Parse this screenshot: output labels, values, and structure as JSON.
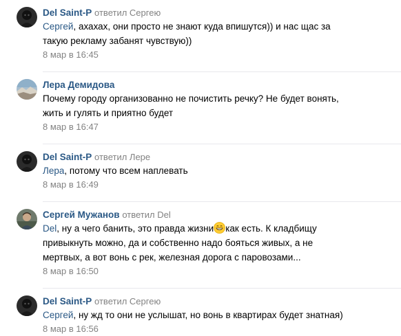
{
  "comments": [
    {
      "author": "Del Saint-P",
      "reply_word": "ответил",
      "reply_target": "Сергею",
      "avatar": "avatar-dark",
      "mention": "Сергей",
      "lines": [
        ", ахахах, они просто не знают куда впишутся)) и нас щас за",
        "такую рекламу забанят чувствую))"
      ],
      "date": "8 мар в 16:45"
    },
    {
      "author": "Лера Демидова",
      "reply_word": "",
      "reply_target": "",
      "avatar": "avatar-landscape",
      "mention": "",
      "lines": [
        "Почему городу организованно не почистить речку? Не будет вонять,",
        "жить и гулять и приятно будет"
      ],
      "date": "8 мар в 16:47"
    },
    {
      "author": "Del Saint-P",
      "reply_word": "ответил",
      "reply_target": "Лере",
      "avatar": "avatar-dark",
      "mention": "Лера",
      "lines": [
        ", потому что всем наплевать"
      ],
      "date": "8 мар в 16:49"
    },
    {
      "author": "Сергей Мужанов",
      "reply_word": "ответил",
      "reply_target": "Del",
      "avatar": "avatar-photo",
      "mention": "Del",
      "line1_before_emoji": ", ну а чего банить, это правда жизни",
      "line1_after_emoji": "как есть. К кладбищу",
      "lines": [
        "привыкнуть можно, да и собственно надо бояться живых, а не",
        "мертвых, а вот вонь с рек, железная дорога с паровозами..."
      ],
      "emoji": "grinning-face-emoji",
      "date": "8 мар в 16:50"
    },
    {
      "author": "Del Saint-P",
      "reply_word": "ответил",
      "reply_target": "Сергею",
      "avatar": "avatar-dark",
      "mention": "Сергей",
      "lines": [
        ", ну жд то они не услышат, но вонь в квартирах будет знатная)"
      ],
      "date": "8 мар в 16:56"
    }
  ],
  "colors": {
    "link": "#2a5885",
    "meta": "#828282",
    "divider": "#e7e8ec",
    "text": "#000000"
  }
}
